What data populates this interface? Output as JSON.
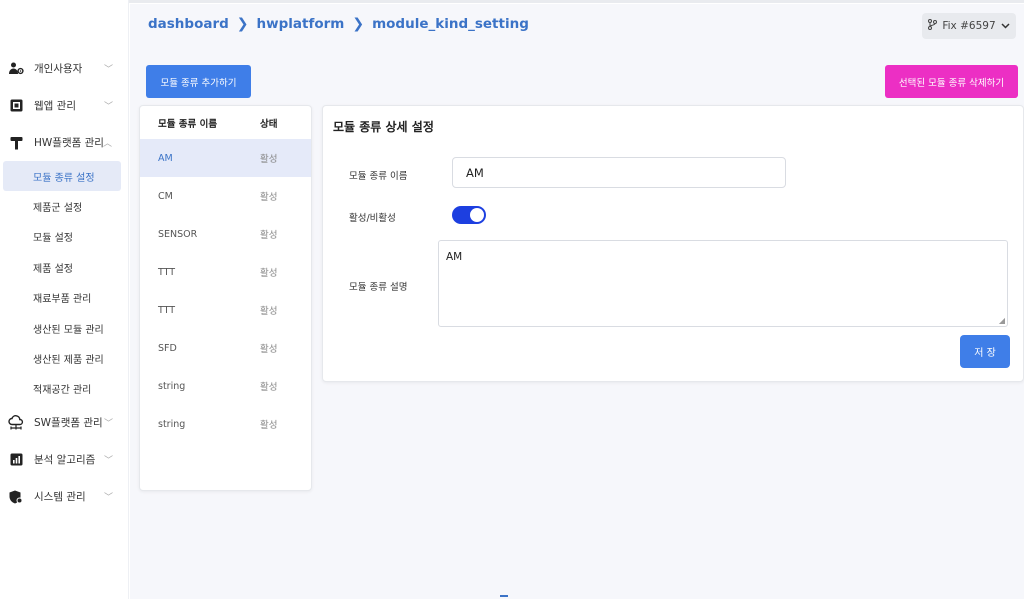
{
  "breadcrumb": [
    "dashboard",
    "hwplatform",
    "module_kind_setting"
  ],
  "breadcrumb_sep": "❯",
  "branch": {
    "label": "Fix #6597",
    "icon": "git-branch-icon"
  },
  "sidebar": {
    "groups": [
      {
        "label": "개인사용자",
        "icon": "user-settings-icon",
        "expanded": false
      },
      {
        "label": "웹앱 관리",
        "icon": "webapp-icon",
        "expanded": false
      },
      {
        "label": "HW플랫폼 관리",
        "icon": "hammer-icon",
        "expanded": true
      },
      {
        "label": "SW플랫폼 관리",
        "icon": "cloud-network-icon",
        "expanded": false
      },
      {
        "label": "분석 알고리즘",
        "icon": "bar-chart-icon",
        "expanded": false
      },
      {
        "label": "시스템 관리",
        "icon": "shield-gear-icon",
        "expanded": false
      }
    ],
    "hw_items": [
      {
        "label": "모듈 종류 설정",
        "active": true
      },
      {
        "label": "제품군 설정"
      },
      {
        "label": "모듈 설정"
      },
      {
        "label": "제품 설정"
      },
      {
        "label": "재료부품 관리"
      },
      {
        "label": "생산된 모듈 관리"
      },
      {
        "label": "생산된 제품 관리"
      },
      {
        "label": "적재공간 관리"
      }
    ]
  },
  "toolbar": {
    "add_label": "모듈 종류 추가하기",
    "delete_label": "선택된 모듈 종류 삭제하기"
  },
  "list": {
    "headers": {
      "name": "모듈 종류 이름",
      "status": "상태"
    },
    "rows": [
      {
        "name": "AM",
        "status": "활성",
        "selected": true
      },
      {
        "name": "CM",
        "status": "활성"
      },
      {
        "name": "SENSOR",
        "status": "활성"
      },
      {
        "name": "TTT",
        "status": "활성"
      },
      {
        "name": "TTT",
        "status": "활성"
      },
      {
        "name": "SFD",
        "status": "활성"
      },
      {
        "name": "string",
        "status": "활성"
      },
      {
        "name": "string",
        "status": "활성"
      }
    ]
  },
  "detail": {
    "title": "모듈 종류 상세 설정",
    "name_label": "모듈 종류 이름",
    "name_value": "AM",
    "active_label": "활성/비활성",
    "active": true,
    "desc_label": "모듈 종류 설명",
    "desc_value": "AM",
    "save_label": "저 장"
  },
  "colors": {
    "primary": "#3f7ee8",
    "danger": "#ec2fc4",
    "toggle": "#1d3fe0",
    "link": "#3b73c7"
  }
}
